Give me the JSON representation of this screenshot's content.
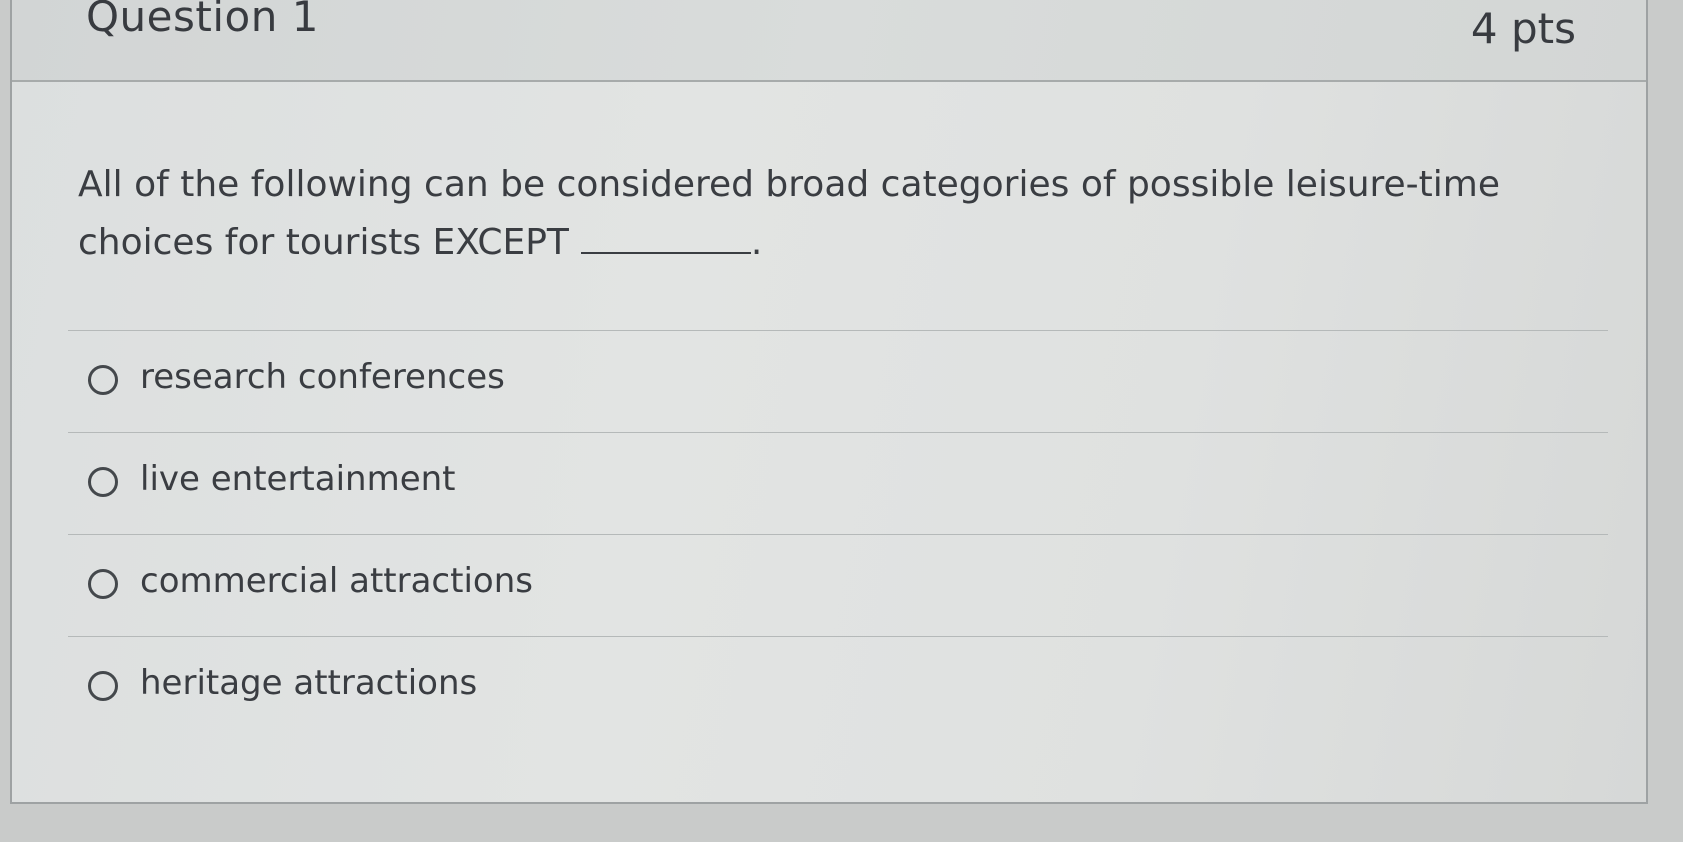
{
  "question": {
    "title": "Question 1",
    "points": "4 pts",
    "text": "All of the following can be considered broad categories of possible leisure-time choices for tourists EXCEPT",
    "text_end": "."
  },
  "answers": [
    {
      "label": "research conferences",
      "selected": false
    },
    {
      "label": "live entertainment",
      "selected": false
    },
    {
      "label": "commercial attractions",
      "selected": false
    },
    {
      "label": "heritage attractions",
      "selected": false
    }
  ]
}
